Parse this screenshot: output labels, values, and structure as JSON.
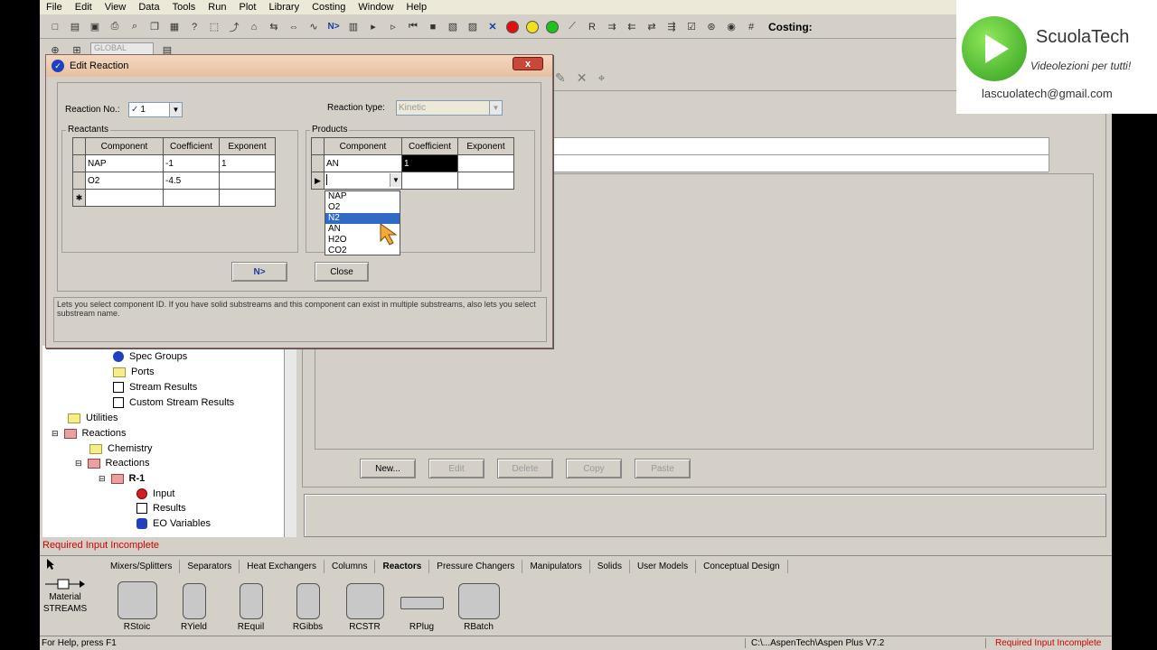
{
  "menu": [
    "File",
    "Edit",
    "View",
    "Data",
    "Tools",
    "Run",
    "Plot",
    "Library",
    "Costing",
    "Window",
    "Help"
  ],
  "toolbar": {
    "costing_label": "Costing:",
    "n_arrow": "N>",
    "global": "GLOBAL"
  },
  "dialog": {
    "title": "Edit Reaction",
    "close_symbol": "x",
    "reaction_no_label": "Reaction No.:",
    "reaction_no_value": "1",
    "reaction_type_label": "Reaction type:",
    "reaction_type_value": "Kinetic",
    "reactants_label": "Reactants",
    "products_label": "Products",
    "columns": [
      "Component",
      "Coefficient",
      "Exponent"
    ],
    "reactants": [
      {
        "component": "NAP",
        "coefficient": "-1",
        "exponent": "1"
      },
      {
        "component": "O2",
        "coefficient": "-4.5",
        "exponent": ""
      }
    ],
    "products": [
      {
        "component": "AN",
        "coefficient": "1",
        "exponent": ""
      }
    ],
    "dropdown_options": [
      "NAP",
      "O2",
      "N2",
      "AN",
      "H2O",
      "CO2"
    ],
    "dropdown_selected": "N2",
    "next_button": "N>",
    "close_button": "Close",
    "help_text": "Lets you select component ID. If you have solid substreams and this component can exist in multiple substreams, also lets you select substream name."
  },
  "tree": {
    "items": [
      {
        "label": "Spec Groups"
      },
      {
        "label": "Ports"
      },
      {
        "label": "Stream Results"
      },
      {
        "label": "Custom Stream Results"
      },
      {
        "label": "Utilities"
      },
      {
        "label": "Reactions"
      },
      {
        "label": "Chemistry"
      },
      {
        "label": "Reactions"
      },
      {
        "label": "R-1"
      },
      {
        "label": "Input"
      },
      {
        "label": "Results"
      },
      {
        "label": "EO Variables"
      }
    ]
  },
  "buttons": {
    "new": "New...",
    "edit": "Edit",
    "delete": "Delete",
    "copy": "Copy",
    "paste": "Paste"
  },
  "status_required": "Required Input Incomplete",
  "palette": {
    "tabs": [
      "Mixers/Splitters",
      "Separators",
      "Heat Exchangers",
      "Columns",
      "Reactors",
      "Pressure Changers",
      "Manipulators",
      "Solids",
      "User Models",
      "Conceptual Design"
    ],
    "active_tab": "Reactors",
    "material_label": "Material",
    "streams_label": "STREAMS",
    "units": [
      "RStoic",
      "RYield",
      "REquil",
      "RGibbs",
      "RCSTR",
      "RPlug",
      "RBatch"
    ]
  },
  "statusbar": {
    "help": "For Help, press F1",
    "path": "C:\\...AspenTech\\Aspen Plus V7.2",
    "required": "Required Input Incomplete"
  },
  "logo": {
    "name": "ScuolaTech",
    "subtitle": "Videolezioni per tutti!",
    "email": "lascuolatech@gmail.com"
  }
}
